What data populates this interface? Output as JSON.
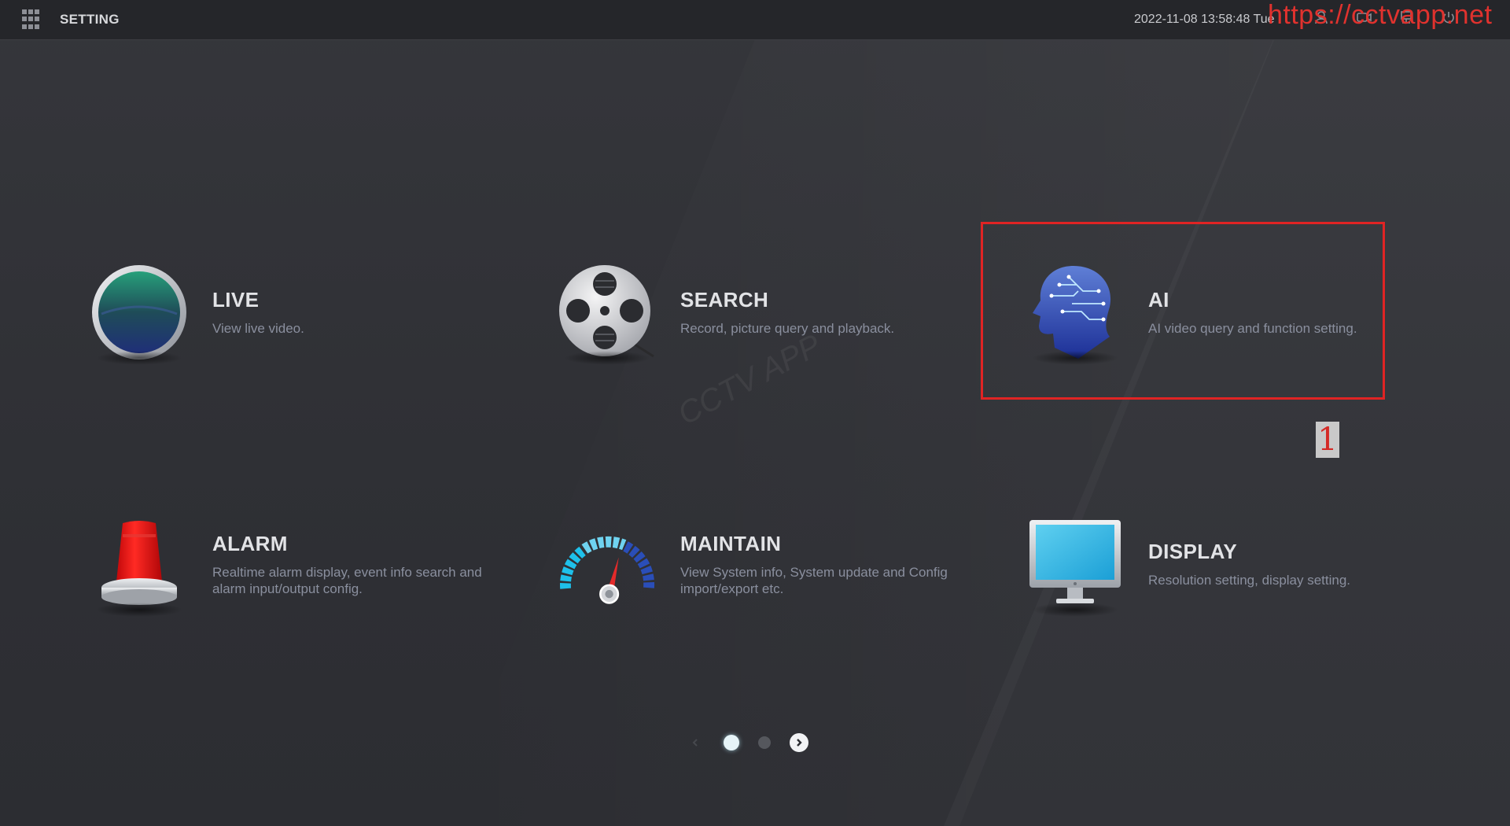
{
  "header": {
    "title": "SETTING",
    "datetime": "2022-11-08 13:58:48 Tue",
    "icons": [
      "user-icon",
      "record-icon",
      "network-icon",
      "shutdown-icon"
    ]
  },
  "watermark": {
    "url": "https://cctvapp.net",
    "center": "CCTV APP"
  },
  "tiles": [
    {
      "name": "LIVE",
      "desc": "View live video.",
      "icon": "live-lens-icon"
    },
    {
      "name": "SEARCH",
      "desc": "Record, picture query and playback.",
      "icon": "film-reel-icon"
    },
    {
      "name": "AI",
      "desc": "AI video query and function setting.",
      "icon": "ai-head-icon"
    },
    {
      "name": "ALARM",
      "desc": "Realtime alarm display, event info search and alarm input/output config.",
      "icon": "alarm-siren-icon"
    },
    {
      "name": "MAINTAIN",
      "desc": "View System info, System update and Config import/export etc.",
      "icon": "gauge-icon"
    },
    {
      "name": "DISPLAY",
      "desc": "Resolution setting, display setting.",
      "icon": "monitor-icon"
    }
  ],
  "annotation": {
    "highlight_target": "AI",
    "marker_label": "1",
    "highlight_color": "#e02424"
  },
  "pager": {
    "pages": 2,
    "current": 1
  },
  "colors": {
    "background": "#2f3035",
    "topbar": "#25262a",
    "title_text": "#e2e3e6",
    "desc_text": "#8a8f9e"
  }
}
